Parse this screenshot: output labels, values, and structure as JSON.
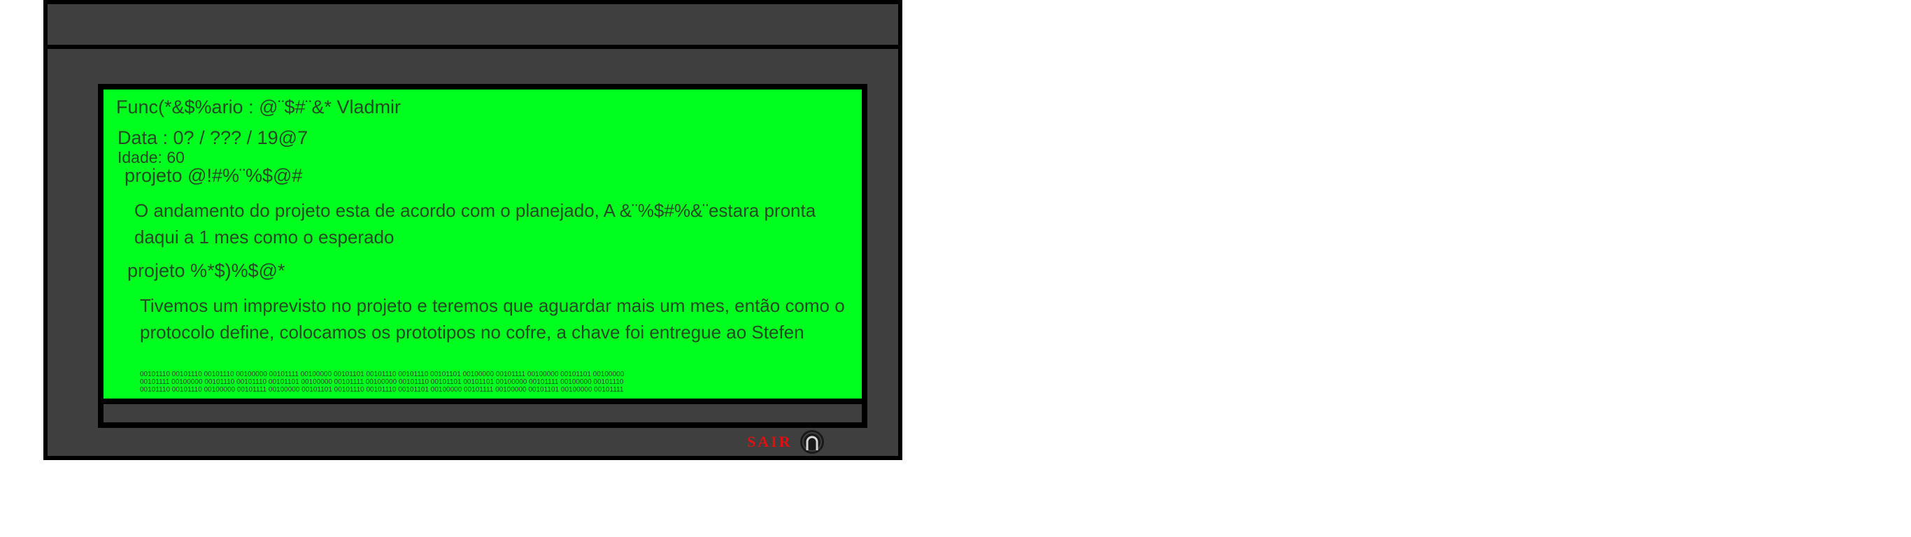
{
  "record": {
    "employee": "Func(*&$%ario :  @¨$#¨&* Vladmir",
    "date": "Data : 0? / ??? / 19@7",
    "age": "Idade: 60",
    "projects": [
      {
        "title": "projeto @!#%¨%$@#",
        "body": "O andamento do projeto esta de acordo com o planejado, A &¨%$#%&¨estara pronta daqui a 1 mes como o esperado"
      },
      {
        "title": "projeto %*$)%$@*",
        "body": "Tivemos um imprevisto no projeto e teremos que aguardar mais um mes, então como o protocolo define, colocamos os prototipos no cofre, a chave foi entregue ao Stefen"
      }
    ],
    "binary_lines": [
      "00101110 00101110 00101110 00100000 00101111 00100000 00101101 00101110 00101110 00101101 00100000 00101111 00100000 00101101 00100000",
      "00101111 00100000 00101110 00101110 00101101 00100000 00101111 00100000 00101110 00101101 00101101 00100000 00101111 00100000 00101110",
      "00101110 00101110 00100000 00101111 00100000 00101101 00101110 00101110 00101101 00100000 00101111 00100000 00101101 00100000 00101111"
    ]
  },
  "controls": {
    "exit_label": "SAIR",
    "exit_icon": "power-icon"
  },
  "colors": {
    "screen": "#00ff1e",
    "frame": "#3f3f3f",
    "exit": "#e01010"
  }
}
